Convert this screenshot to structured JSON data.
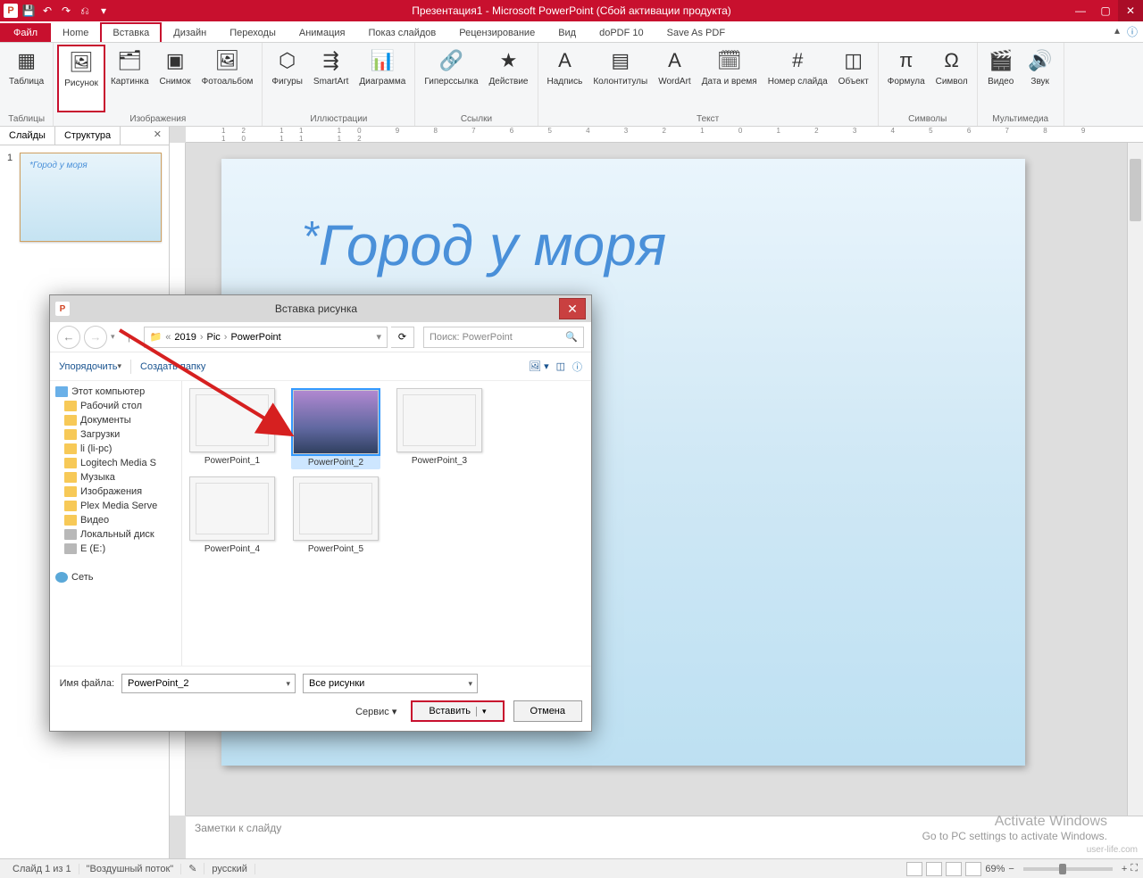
{
  "window": {
    "title": "Презентация1 - Microsoft PowerPoint (Сбой активации продукта)"
  },
  "tabs": {
    "file": "Файл",
    "items": [
      "Home",
      "Вставка",
      "Дизайн",
      "Переходы",
      "Анимация",
      "Показ слайдов",
      "Рецензирование",
      "Вид",
      "doPDF 10",
      "Save As PDF"
    ],
    "active_index": 1
  },
  "ribbon": {
    "groups": [
      {
        "label": "Таблицы",
        "buttons": [
          {
            "label": "Таблица",
            "icon": "▦"
          }
        ]
      },
      {
        "label": "Изображения",
        "buttons": [
          {
            "label": "Рисунок",
            "icon": "🖼",
            "highlighted": true
          },
          {
            "label": "Картинка",
            "icon": "🗂"
          },
          {
            "label": "Снимок",
            "icon": "▣"
          },
          {
            "label": "Фотоальбом",
            "icon": "🖼"
          }
        ]
      },
      {
        "label": "Иллюстрации",
        "buttons": [
          {
            "label": "Фигуры",
            "icon": "⬡"
          },
          {
            "label": "SmartArt",
            "icon": "⇶"
          },
          {
            "label": "Диаграмма",
            "icon": "📊"
          }
        ]
      },
      {
        "label": "Ссылки",
        "buttons": [
          {
            "label": "Гиперссылка",
            "icon": "🔗"
          },
          {
            "label": "Действие",
            "icon": "★"
          }
        ]
      },
      {
        "label": "Текст",
        "buttons": [
          {
            "label": "Надпись",
            "icon": "A"
          },
          {
            "label": "Колонтитулы",
            "icon": "▤"
          },
          {
            "label": "WordArt",
            "icon": "A"
          },
          {
            "label": "Дата и время",
            "icon": "🗓"
          },
          {
            "label": "Номер слайда",
            "icon": "#"
          },
          {
            "label": "Объект",
            "icon": "◫"
          }
        ]
      },
      {
        "label": "Символы",
        "buttons": [
          {
            "label": "Формула",
            "icon": "π"
          },
          {
            "label": "Символ",
            "icon": "Ω"
          }
        ]
      },
      {
        "label": "Мультимедиа",
        "buttons": [
          {
            "label": "Видео",
            "icon": "🎬"
          },
          {
            "label": "Звук",
            "icon": "🔊"
          }
        ]
      }
    ]
  },
  "slides_panel": {
    "tab_slides": "Слайды",
    "tab_outline": "Структура",
    "items": [
      {
        "num": "1",
        "title": "Город у моря"
      }
    ]
  },
  "slide": {
    "title": "Город у моря"
  },
  "notes": {
    "placeholder": "Заметки к слайду"
  },
  "ruler": "12  11  10  9  8  7  6  5  4  3  2  1  0  1  2  3  4  5  6  7  8  9  10  11  12",
  "status": {
    "slide_info": "Слайд 1 из 1",
    "theme": "\"Воздушный поток\"",
    "lang": "русский",
    "zoom": "69%"
  },
  "dialog": {
    "title": "Вставка рисунка",
    "breadcrumb": [
      "2019",
      "Pic",
      "PowerPoint"
    ],
    "search_placeholder": "Поиск: PowerPoint",
    "organize": "Упорядочить",
    "new_folder": "Создать папку",
    "tree": [
      {
        "label": "Этот компьютер",
        "icon": "pc",
        "root": true
      },
      {
        "label": "Рабочий стол",
        "icon": "folder"
      },
      {
        "label": "Документы",
        "icon": "folder"
      },
      {
        "label": "Загрузки",
        "icon": "folder"
      },
      {
        "label": "li (li-pc)",
        "icon": "folder"
      },
      {
        "label": "Logitech Media S",
        "icon": "folder"
      },
      {
        "label": "Музыка",
        "icon": "folder"
      },
      {
        "label": "Изображения",
        "icon": "folder"
      },
      {
        "label": "Plex Media Serve",
        "icon": "folder"
      },
      {
        "label": "Видео",
        "icon": "folder"
      },
      {
        "label": "Локальный диск",
        "icon": "drive"
      },
      {
        "label": "E (E:)",
        "icon": "drive"
      },
      {
        "label": "Сеть",
        "icon": "net",
        "root": true
      }
    ],
    "files": [
      {
        "name": "PowerPoint_1",
        "selected": false
      },
      {
        "name": "PowerPoint_2",
        "selected": true
      },
      {
        "name": "PowerPoint_3",
        "selected": false
      },
      {
        "name": "PowerPoint_4",
        "selected": false
      },
      {
        "name": "PowerPoint_5",
        "selected": false
      }
    ],
    "filename_label": "Имя файла:",
    "filename_value": "PowerPoint_2",
    "filter": "Все рисунки",
    "service": "Сервис",
    "insert": "Вставить",
    "cancel": "Отмена"
  },
  "watermark": {
    "line1": "Activate Windows",
    "line2": "Go to PC settings to activate Windows."
  },
  "brand": "user-life.com"
}
